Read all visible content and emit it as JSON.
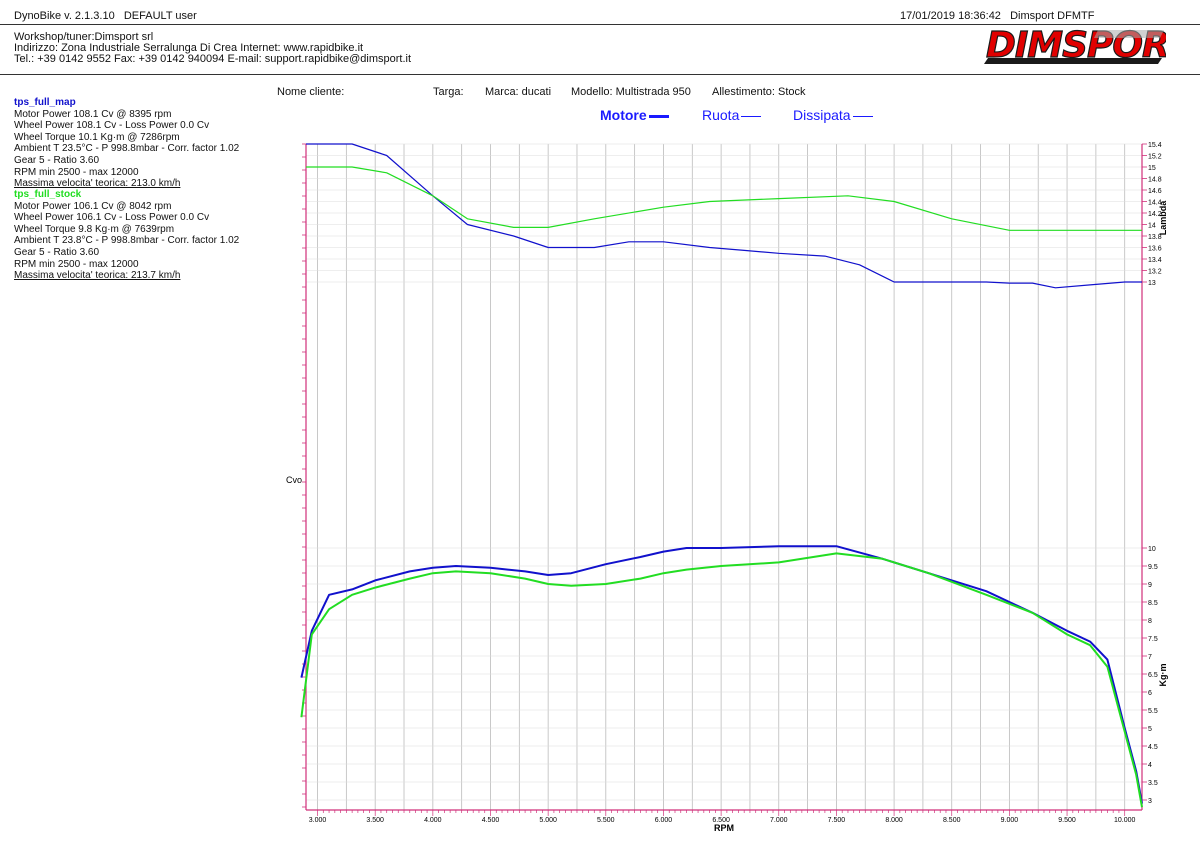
{
  "header": {
    "app_version": "DynoBike v. 2.1.3.10",
    "user": "DEFAULT user",
    "datetime": "17/01/2019 18:36:42",
    "station": "Dimsport DFMTF",
    "workshop_line": "Workshop/tuner:Dimsport srl",
    "address_line": "Indirizzo: Zona Industriale Serralunga Di Crea Internet: www.rapidbike.it",
    "contact_line": "Tel.: +39 0142 9552 Fax: +39 0142 940094 E-mail: support.rapidbike@dimsport.it",
    "logo_text": "DIMSPORT"
  },
  "vehicle": {
    "cliente": "Nome cliente:",
    "targa": "Targa:",
    "marca": "Marca: ducati",
    "modello": "Modello: Multistrada 950",
    "allestimento": "Allestimento: Stock"
  },
  "legend": {
    "motore": "Motore",
    "ruota": "Ruota",
    "dissipata": "Dissipata"
  },
  "colors": {
    "map": "#1111cc",
    "stock": "#22dd22",
    "legend_text": "#1a1aff",
    "axis": "#d0307a",
    "grid": "#bbbbbb"
  },
  "runs": [
    {
      "name": "tps_full_map",
      "color": "#1111cc",
      "lines": [
        "Motor Power 108.1 Cv  @ 8395 rpm",
        "Wheel Power 108.1 Cv  - Loss Power 0.0 Cv",
        "Wheel Torque 10.1 Kg·m  @ 7286rpm",
        "Ambient T 23.5°C - P 998.8mbar - Corr. factor 1.02",
        "Gear 5 - Ratio 3.60",
        "RPM min 2500 - max 12000"
      ],
      "vmax": "Massima velocita' teorica: 213.0 km/h"
    },
    {
      "name": "tps_full_stock",
      "color": "#22dd22",
      "lines": [
        "Motor Power 106.1 Cv  @ 8042 rpm",
        "Wheel Power 106.1 Cv  - Loss Power 0.0 Cv",
        "Wheel Torque 9.8 Kg·m  @ 7639rpm",
        "Ambient T 23.8°C - P 998.8mbar - Corr. factor 1.02",
        "Gear 5 - Ratio 3.60",
        "RPM min 2500 - max 12000"
      ],
      "vmax": "Massima velocita' teorica: 213.7 km/h"
    }
  ],
  "chart_data": [
    {
      "type": "line",
      "title": "",
      "xlabel": "RPM",
      "ylabel": "Lambda",
      "ylim": [
        13.0,
        15.4
      ],
      "xlim": [
        2900,
        10150
      ],
      "y_ticks": [
        "15.4",
        "15.2",
        "15",
        "14.8",
        "14.6",
        "14.4",
        "14.2",
        "14",
        "13.8",
        "13.6",
        "13.4",
        "13.2",
        "13"
      ],
      "series": [
        {
          "name": "tps_full_map",
          "x": [
            2900,
            3000,
            3300,
            3600,
            4000,
            4300,
            4700,
            5000,
            5400,
            5700,
            6000,
            6400,
            6700,
            7000,
            7400,
            7700,
            8000,
            8500,
            8800,
            9000,
            9200,
            9400,
            9700,
            10000,
            10150
          ],
          "y": [
            15.4,
            15.4,
            15.4,
            15.2,
            14.5,
            14.0,
            13.8,
            13.6,
            13.6,
            13.7,
            13.7,
            13.6,
            13.55,
            13.5,
            13.45,
            13.3,
            13.0,
            13.0,
            13.0,
            12.98,
            12.98,
            12.9,
            12.95,
            13.0,
            13.0
          ]
        },
        {
          "name": "tps_full_stock",
          "x": [
            2900,
            3300,
            3600,
            4000,
            4300,
            4700,
            5000,
            5400,
            6000,
            6400,
            7000,
            7600,
            8000,
            8500,
            9000,
            9500,
            10000,
            10150
          ],
          "y": [
            15.0,
            15.0,
            14.9,
            14.5,
            14.1,
            13.95,
            13.95,
            14.1,
            14.3,
            14.4,
            14.45,
            14.5,
            14.4,
            14.1,
            13.9,
            13.9,
            13.9,
            13.9
          ]
        }
      ]
    },
    {
      "type": "line",
      "title": "",
      "xlabel": "RPM",
      "ylabel": "Kg·m",
      "ylim": [
        2.8,
        10.2
      ],
      "xlim": [
        2900,
        10150
      ],
      "x_ticks": [
        "3.000",
        "3.500",
        "4.000",
        "4.500",
        "5.000",
        "5.500",
        "6.000",
        "6.500",
        "7.000",
        "7.500",
        "8.000",
        "8.500",
        "9.000",
        "9.500",
        "10.000"
      ],
      "y_ticks": [
        "10",
        "9.5",
        "9",
        "8.5",
        "8",
        "7.5",
        "7",
        "6.5",
        "6",
        "5.5",
        "5",
        "4.5",
        "4",
        "3.5",
        "3"
      ],
      "series": [
        {
          "name": "tps_full_map",
          "x": [
            2860,
            2950,
            3100,
            3300,
            3500,
            3800,
            4000,
            4200,
            4500,
            4800,
            5000,
            5200,
            5500,
            5800,
            6000,
            6200,
            6500,
            7000,
            7500,
            7900,
            8300,
            8800,
            9200,
            9500,
            9700,
            9850,
            10000,
            10100,
            10150
          ],
          "y": [
            6.4,
            7.7,
            8.7,
            8.85,
            9.1,
            9.35,
            9.45,
            9.5,
            9.45,
            9.35,
            9.25,
            9.3,
            9.55,
            9.75,
            9.9,
            10.0,
            10.0,
            10.05,
            10.05,
            9.7,
            9.3,
            8.8,
            8.2,
            7.7,
            7.4,
            6.9,
            5.0,
            3.8,
            2.9
          ]
        },
        {
          "name": "tps_full_stock",
          "x": [
            2860,
            2950,
            3100,
            3300,
            3500,
            3800,
            4000,
            4200,
            4500,
            4800,
            5000,
            5200,
            5500,
            5800,
            6000,
            6200,
            6500,
            7000,
            7500,
            7900,
            8300,
            8800,
            9200,
            9500,
            9700,
            9850,
            10000,
            10100,
            10150
          ],
          "y": [
            5.3,
            7.6,
            8.3,
            8.7,
            8.9,
            9.15,
            9.3,
            9.35,
            9.3,
            9.15,
            9.0,
            8.95,
            9.0,
            9.15,
            9.3,
            9.4,
            9.5,
            9.6,
            9.85,
            9.7,
            9.3,
            8.7,
            8.2,
            7.6,
            7.3,
            6.7,
            4.9,
            3.7,
            2.8
          ]
        }
      ]
    }
  ],
  "cvo_label": "Cvo"
}
